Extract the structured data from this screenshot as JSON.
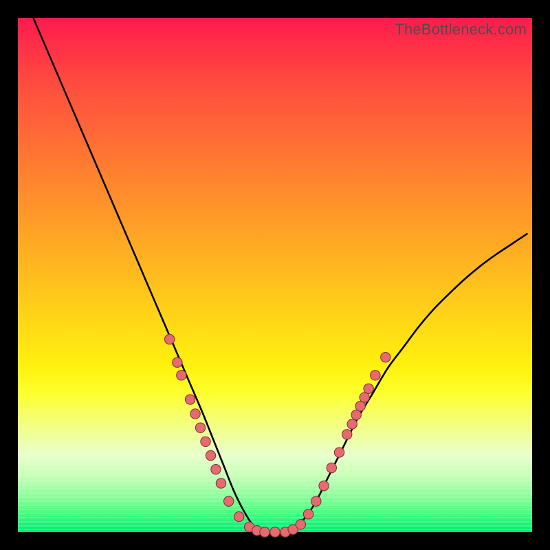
{
  "watermark": "TheBottleneck.com",
  "colors": {
    "frame": "#000000",
    "curve_stroke": "#000000",
    "dot_fill": "#e66a6f",
    "dot_stroke": "#7a2e33",
    "watermark": "#4d4d4d"
  },
  "chart_data": {
    "type": "line",
    "title": "",
    "xlabel": "",
    "ylabel": "",
    "xlim": [
      0,
      100
    ],
    "ylim": [
      0,
      100
    ],
    "series": [
      {
        "name": "bottleneck-curve",
        "x": [
          3,
          6,
          9,
          12,
          15,
          18,
          21,
          24,
          27,
          30,
          33,
          36,
          38,
          40,
          42,
          44,
          46,
          48,
          50,
          52,
          54,
          56,
          58,
          60,
          63,
          66,
          69,
          72,
          75,
          78,
          81,
          84,
          87,
          90,
          93,
          96,
          99
        ],
        "y": [
          100,
          93,
          86,
          79,
          72,
          65,
          58,
          51,
          44,
          37,
          30,
          23,
          18,
          13,
          8,
          4,
          1,
          0,
          0,
          0,
          1,
          3,
          6,
          10,
          16,
          22,
          27,
          32,
          36,
          40,
          43.5,
          46.5,
          49.3,
          51.8,
          54,
          56,
          58
        ]
      }
    ],
    "scatter_dots": {
      "name": "highlight-dots",
      "points": [
        {
          "x": 29.5,
          "y": 37.5
        },
        {
          "x": 31.0,
          "y": 33.0
        },
        {
          "x": 31.8,
          "y": 30.5
        },
        {
          "x": 33.5,
          "y": 25.8
        },
        {
          "x": 34.5,
          "y": 23.0
        },
        {
          "x": 35.5,
          "y": 20.3
        },
        {
          "x": 36.5,
          "y": 17.6
        },
        {
          "x": 37.5,
          "y": 14.9
        },
        {
          "x": 38.5,
          "y": 12.2
        },
        {
          "x": 39.5,
          "y": 9.5
        },
        {
          "x": 41.0,
          "y": 6.0
        },
        {
          "x": 43.0,
          "y": 3.0
        },
        {
          "x": 45.0,
          "y": 1.0
        },
        {
          "x": 46.5,
          "y": 0.3
        },
        {
          "x": 48.0,
          "y": 0.0
        },
        {
          "x": 50.0,
          "y": 0.0
        },
        {
          "x": 52.0,
          "y": 0.0
        },
        {
          "x": 53.5,
          "y": 0.5
        },
        {
          "x": 55.0,
          "y": 1.5
        },
        {
          "x": 56.5,
          "y": 3.5
        },
        {
          "x": 58.0,
          "y": 6.0
        },
        {
          "x": 59.5,
          "y": 9.0
        },
        {
          "x": 61.0,
          "y": 12.5
        },
        {
          "x": 62.5,
          "y": 15.5
        },
        {
          "x": 64.0,
          "y": 19.0
        },
        {
          "x": 65.0,
          "y": 21.0
        },
        {
          "x": 65.8,
          "y": 22.8
        },
        {
          "x": 66.6,
          "y": 24.5
        },
        {
          "x": 67.4,
          "y": 26.2
        },
        {
          "x": 68.2,
          "y": 27.9
        },
        {
          "x": 69.5,
          "y": 30.5
        },
        {
          "x": 71.5,
          "y": 34.0
        }
      ]
    },
    "horizontal_band_lines_y": [
      0.5,
      1.2,
      2.0,
      2.8,
      3.6,
      4.4,
      5.2,
      6.0,
      6.8,
      7.6,
      8.4,
      9.2,
      10.0,
      11.0,
      12.2,
      13.6,
      15.2,
      17.0,
      19.0,
      21.2,
      23.6
    ]
  }
}
